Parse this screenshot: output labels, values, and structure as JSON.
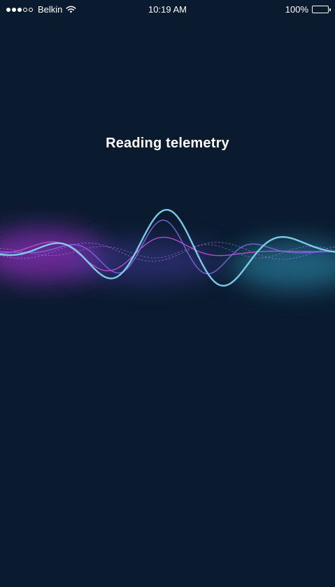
{
  "status_bar": {
    "signal_filled": 3,
    "signal_total": 5,
    "carrier": "Belkin",
    "time": "10:19 AM",
    "battery_percent": "100%",
    "battery_level": 1.0
  },
  "main": {
    "title": "Reading telemetry"
  },
  "colors": {
    "background": "#0a1b2f",
    "wave_primary": "#7fd4ec",
    "wave_secondary": "#7a67e0",
    "wave_magenta": "#c84fd8",
    "glow_left": "#8a2fb8",
    "glow_right": "#2f8fb0"
  },
  "icons": {
    "wifi": "wifi-icon",
    "battery": "battery-icon",
    "signal": "signal-strength-icon"
  }
}
